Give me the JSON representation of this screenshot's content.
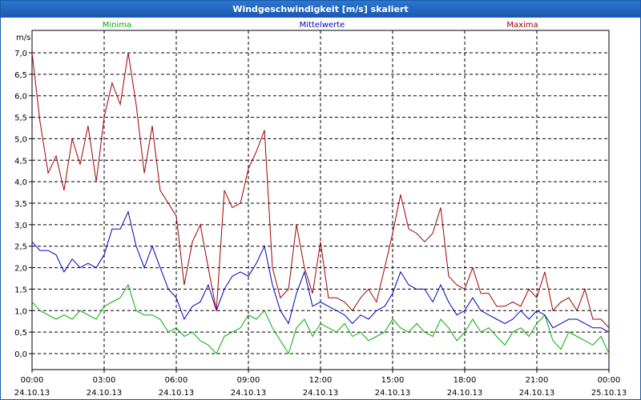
{
  "window": {
    "title": "Windgeschwindigkeit [m/s] skaliert"
  },
  "chart_data": {
    "type": "line",
    "title": "Windgeschwindigkeit [m/s] skaliert",
    "ylabel": "m/s",
    "ylim": [
      0,
      7.5
    ],
    "xlim_hours": [
      0,
      24
    ],
    "grid": true,
    "legend_placement": "top",
    "yticks": [
      "0,0",
      "0,5",
      "1,0",
      "1,5",
      "2,0",
      "2,5",
      "3,0",
      "3,5",
      "4,0",
      "4,5",
      "5,0",
      "5,5",
      "6,0",
      "6,5",
      "7,0"
    ],
    "xticks": [
      {
        "time": "00:00",
        "date": "24.10.13"
      },
      {
        "time": "03:00",
        "date": "24.10.13"
      },
      {
        "time": "06:00",
        "date": "24.10.13"
      },
      {
        "time": "09:00",
        "date": "24.10.13"
      },
      {
        "time": "12:00",
        "date": "24.10.13"
      },
      {
        "time": "15:00",
        "date": "24.10.13"
      },
      {
        "time": "18:00",
        "date": "24.10.13"
      },
      {
        "time": "21:00",
        "date": "24.10.13"
      },
      {
        "time": "00:00",
        "date": "25.10.13"
      }
    ],
    "series": [
      {
        "name": "Minima",
        "color": "#00b000",
        "x": [
          0,
          0.33,
          0.67,
          1.0,
          1.33,
          1.67,
          2.0,
          2.33,
          2.67,
          3.0,
          3.33,
          3.67,
          4.0,
          4.33,
          4.67,
          5.0,
          5.33,
          5.67,
          6.0,
          6.33,
          6.67,
          7.0,
          7.33,
          7.67,
          8.0,
          8.33,
          8.67,
          9.0,
          9.33,
          9.67,
          10.0,
          10.33,
          10.67,
          11.0,
          11.33,
          11.67,
          12.0,
          12.33,
          12.67,
          13.0,
          13.33,
          13.67,
          14.0,
          14.33,
          14.67,
          15.0,
          15.33,
          15.67,
          16.0,
          16.33,
          16.67,
          17.0,
          17.33,
          17.67,
          18.0,
          18.33,
          18.67,
          19.0,
          19.33,
          19.67,
          20.0,
          20.33,
          20.67,
          21.0,
          21.33,
          21.67,
          22.0,
          22.33,
          22.67,
          23.0,
          23.33,
          23.67,
          24.0
        ],
        "y": [
          1.2,
          1.0,
          0.9,
          0.8,
          0.9,
          0.8,
          1.0,
          0.9,
          0.8,
          1.1,
          1.2,
          1.3,
          1.6,
          1.0,
          0.9,
          0.9,
          0.8,
          0.5,
          0.6,
          0.4,
          0.5,
          0.3,
          0.2,
          0.0,
          0.4,
          0.5,
          0.6,
          0.9,
          0.8,
          1.0,
          0.6,
          0.3,
          0.0,
          0.6,
          0.8,
          0.4,
          0.7,
          0.6,
          0.5,
          0.7,
          0.4,
          0.5,
          0.3,
          0.4,
          0.5,
          0.8,
          0.6,
          0.5,
          0.7,
          0.5,
          0.4,
          0.8,
          0.6,
          0.3,
          0.5,
          0.8,
          0.5,
          0.6,
          0.4,
          0.2,
          0.5,
          0.6,
          0.4,
          0.7,
          0.9,
          0.3,
          0.1,
          0.5,
          0.4,
          0.3,
          0.2,
          0.4,
          0.0
        ]
      },
      {
        "name": "Mittelwerte",
        "color": "#0000c0",
        "x": [
          0,
          0.33,
          0.67,
          1.0,
          1.33,
          1.67,
          2.0,
          2.33,
          2.67,
          3.0,
          3.33,
          3.67,
          4.0,
          4.33,
          4.67,
          5.0,
          5.33,
          5.67,
          6.0,
          6.33,
          6.67,
          7.0,
          7.33,
          7.67,
          8.0,
          8.33,
          8.67,
          9.0,
          9.33,
          9.67,
          10.0,
          10.33,
          10.67,
          11.0,
          11.33,
          11.67,
          12.0,
          12.33,
          12.67,
          13.0,
          13.33,
          13.67,
          14.0,
          14.33,
          14.67,
          15.0,
          15.33,
          15.67,
          16.0,
          16.33,
          16.67,
          17.0,
          17.33,
          17.67,
          18.0,
          18.33,
          18.67,
          19.0,
          19.33,
          19.67,
          20.0,
          20.33,
          20.67,
          21.0,
          21.33,
          21.67,
          22.0,
          22.33,
          22.67,
          23.0,
          23.33,
          23.67,
          24.0
        ],
        "y": [
          2.6,
          2.4,
          2.4,
          2.3,
          1.9,
          2.2,
          2.0,
          2.1,
          2.0,
          2.3,
          2.9,
          2.9,
          3.3,
          2.5,
          2.0,
          2.5,
          2.0,
          1.5,
          1.3,
          0.8,
          1.1,
          1.2,
          1.6,
          1.0,
          1.5,
          1.8,
          1.9,
          1.8,
          2.1,
          2.5,
          1.6,
          1.0,
          0.7,
          1.4,
          1.9,
          1.1,
          1.2,
          1.1,
          1.0,
          0.9,
          0.7,
          0.9,
          0.8,
          1.0,
          1.1,
          1.4,
          1.9,
          1.6,
          1.5,
          1.5,
          1.2,
          1.6,
          1.2,
          0.9,
          1.0,
          1.3,
          1.0,
          0.9,
          0.8,
          0.7,
          0.8,
          1.0,
          0.8,
          1.0,
          0.9,
          0.6,
          0.7,
          0.8,
          0.8,
          0.7,
          0.6,
          0.6,
          0.5
        ]
      },
      {
        "name": "Maxima",
        "color": "#a00000",
        "x": [
          0,
          0.33,
          0.67,
          1.0,
          1.33,
          1.67,
          2.0,
          2.33,
          2.67,
          3.0,
          3.33,
          3.67,
          4.0,
          4.33,
          4.67,
          5.0,
          5.33,
          5.67,
          6.0,
          6.33,
          6.67,
          7.0,
          7.33,
          7.67,
          8.0,
          8.33,
          8.67,
          9.0,
          9.33,
          9.67,
          10.0,
          10.33,
          10.67,
          11.0,
          11.33,
          11.67,
          12.0,
          12.33,
          12.67,
          13.0,
          13.33,
          13.67,
          14.0,
          14.33,
          14.67,
          15.0,
          15.33,
          15.67,
          16.0,
          16.33,
          16.67,
          17.0,
          17.33,
          17.67,
          18.0,
          18.33,
          18.67,
          19.0,
          19.33,
          19.67,
          20.0,
          20.33,
          20.67,
          21.0,
          21.33,
          21.67,
          22.0,
          22.33,
          22.67,
          23.0,
          23.33,
          23.67,
          24.0
        ],
        "y": [
          7.0,
          5.4,
          4.2,
          4.6,
          3.8,
          5.0,
          4.4,
          5.3,
          4.0,
          5.5,
          6.3,
          5.8,
          7.0,
          5.8,
          4.2,
          5.3,
          3.8,
          3.5,
          3.2,
          1.6,
          2.6,
          3.0,
          2.0,
          1.0,
          3.8,
          3.4,
          3.5,
          4.3,
          4.7,
          5.2,
          2.0,
          1.3,
          1.5,
          3.0,
          2.0,
          1.4,
          2.6,
          1.3,
          1.3,
          1.2,
          1.0,
          1.3,
          1.5,
          1.2,
          2.0,
          2.8,
          3.7,
          2.9,
          2.8,
          2.6,
          2.8,
          3.4,
          1.8,
          1.6,
          1.5,
          2.0,
          1.4,
          1.4,
          1.1,
          1.1,
          1.2,
          1.1,
          1.5,
          1.3,
          1.9,
          1.0,
          1.2,
          1.3,
          1.0,
          1.5,
          0.8,
          0.8,
          0.6
        ]
      }
    ]
  }
}
